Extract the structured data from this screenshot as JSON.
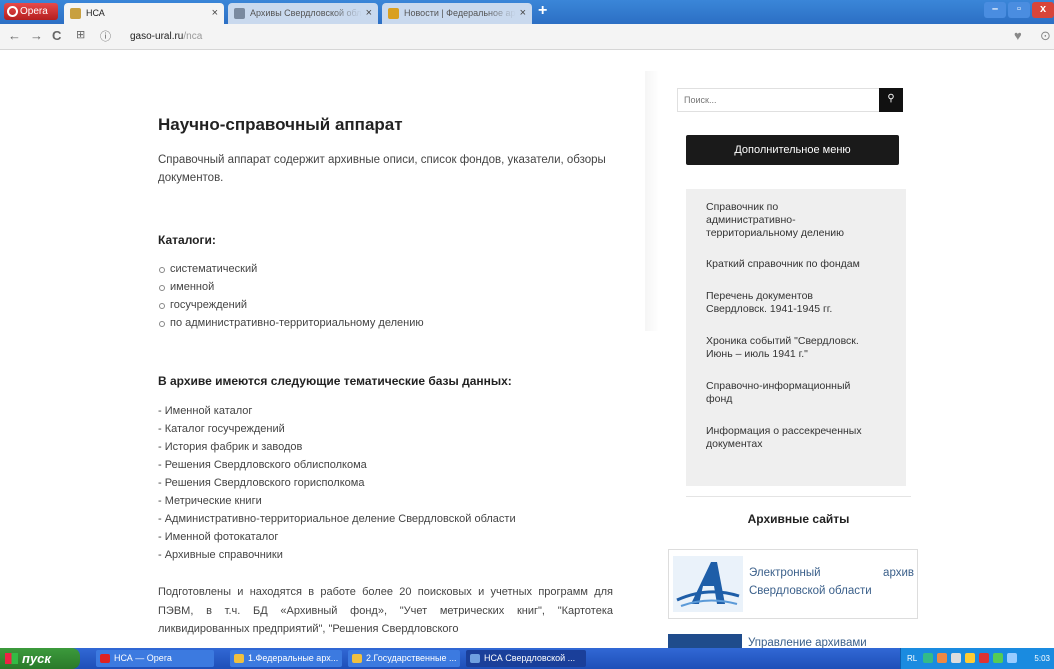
{
  "browser": {
    "menu_label": "Opera",
    "tabs": [
      {
        "title": "НСА",
        "active": true,
        "favicon_color": "#c8a040"
      },
      {
        "title": "Архивы Свердловской обл",
        "active": false,
        "favicon_color": "#7a8aa0"
      },
      {
        "title": "Новости | Федеральное ар",
        "active": false,
        "favicon_color": "#d9a020"
      }
    ],
    "url_domain": "gaso-ural.ru",
    "url_path": "/nca",
    "new_tab_symbol": "+",
    "window_buttons": {
      "minimize": "–",
      "maximize": "▫",
      "close": "x"
    }
  },
  "page": {
    "title": "Научно-справочный аппарат",
    "intro": "Справочный аппарат содержит архивные описи, список фондов, указатели, обзоры документов.",
    "catalogs_heading": "Каталоги:",
    "catalogs": [
      "систематический",
      "именной",
      "госучреждений",
      "по административно-территориальному делению"
    ],
    "databases_heading": "В архиве имеются следующие тематические базы данных:",
    "databases": [
      "- Именной каталог",
      "- Каталог госучреждений",
      "- История фабрик и заводов",
      "- Решения Свердловского облисполкома",
      "- Решения Свердловского горисполкома",
      "- Метрические книги",
      "- Административно-территориальное деление Свердловской области",
      "- Именной фотокаталог",
      "- Архивные справочники"
    ],
    "bottom_paragraph": "Подготовлены и находятся в работе более 20 поисковых и учетных программ для ПЭВМ, в т.ч. БД «Архивный фонд», \"Учет метрических книг\", \"Картотека ликвидированных предприятий\", \"Решения Свердловского"
  },
  "sidebar": {
    "search_placeholder": "Поиск...",
    "search_icon": "search-icon",
    "extra_menu": "Дополнительное меню",
    "links": [
      "Справочник по административно-территориальному делению",
      "Краткий справочник по фондам",
      "Перечень документов Свердловск. 1941-1945 гг.",
      "Хроника событий \"Свердловск. Июнь – июль 1941 г.\"",
      "Справочно-информационный фонд",
      "Информация о рассекреченных документах"
    ],
    "archive_sites_heading": "Архивные сайты",
    "banner1_text": "Электронный архив Свердловской области",
    "banner2_text": "Управление архивами"
  },
  "taskbar": {
    "start_label": "пуск",
    "tasks": [
      {
        "label": "НСА — Opera",
        "active": false,
        "icon_color": "#d22"
      },
      {
        "label": "1.Федеральные арх...",
        "active": false,
        "icon_color": "#f0c040"
      },
      {
        "label": "2.Государственные ...",
        "active": false,
        "icon_color": "#f0c040"
      },
      {
        "label": "НСА Свердловской ...",
        "active": true,
        "icon_color": "#6fa0e0"
      }
    ],
    "language": "RL",
    "clock": "5:03"
  },
  "colors": {
    "tabbar": "#2c6fc4",
    "taskbar": "#1e4fb8",
    "start_button": "#2a7a2a",
    "sidebar_panel": "#efefef",
    "dark_button": "#1a1a1a",
    "link_blue": "#3a5f8a"
  }
}
